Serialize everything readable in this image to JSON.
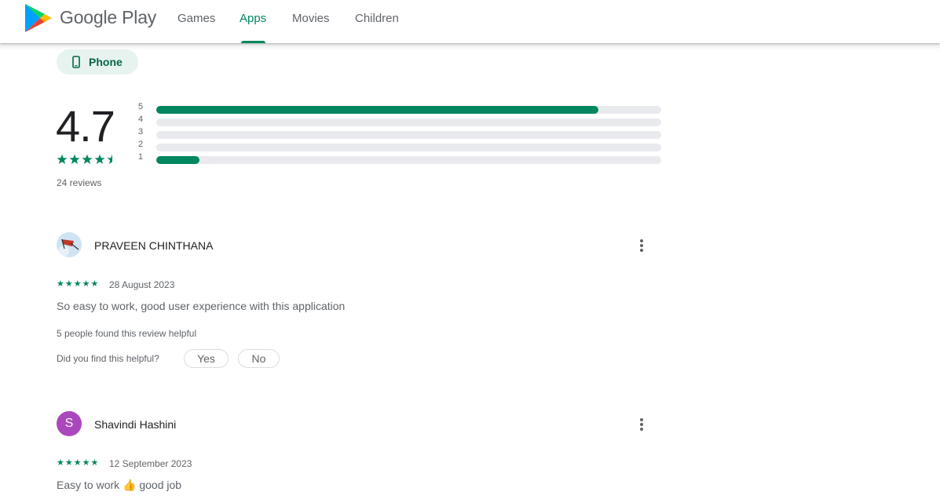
{
  "header": {
    "brand": "Google Play",
    "nav": [
      {
        "label": "Games",
        "active": false
      },
      {
        "label": "Apps",
        "active": true
      },
      {
        "label": "Movies",
        "active": false
      },
      {
        "label": "Children",
        "active": false
      }
    ],
    "accent_color": "#01875f"
  },
  "device_chip": {
    "label": "Phone",
    "icon": "phone-icon"
  },
  "ratings": {
    "average": "4.7",
    "stars_value": 4.5,
    "reviews_count": "24 reviews",
    "histogram": [
      {
        "label": "5",
        "fraction": 0.875
      },
      {
        "label": "4",
        "fraction": 0
      },
      {
        "label": "3",
        "fraction": 0
      },
      {
        "label": "2",
        "fraction": 0
      },
      {
        "label": "1",
        "fraction": 0.085
      }
    ]
  },
  "reviews": [
    {
      "author": "PRAVEEN CHINTHANA",
      "avatar": "profile-picture",
      "stars": "★★★★★",
      "date": "28 August 2023",
      "text": "So easy to work, good user experience with this application",
      "helpful_count": "5 people found this review helpful",
      "helpful_prompt": "Did you find this helpful?",
      "yes_label": "Yes",
      "no_label": "No"
    },
    {
      "author": "Shavindi Hashini",
      "avatar_letter": "S",
      "avatar_color": "#ab47bc",
      "stars": "★★★★★",
      "date": "12 September 2023",
      "text": "Easy to work 👍 good job"
    }
  ]
}
